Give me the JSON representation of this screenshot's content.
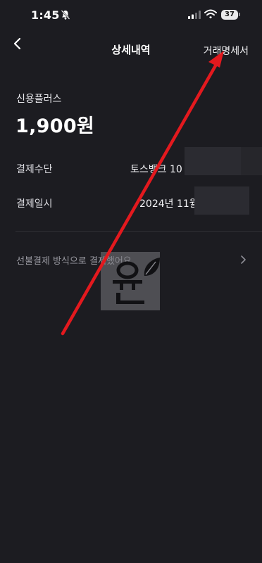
{
  "status_bar": {
    "time": "1:45",
    "battery_level": "37"
  },
  "nav": {
    "title": "상세내역",
    "action_label": "거래명세서"
  },
  "transaction": {
    "merchant": "신용플러스",
    "amount": "1,900원"
  },
  "details": [
    {
      "label": "결제수단",
      "value": "토스뱅크 10"
    },
    {
      "label": "결제일시",
      "value": "2024년 11월"
    }
  ],
  "payment_link": {
    "text": "선불결제 방식으로 결제했어요"
  },
  "watermark": {
    "text": "윤"
  },
  "colors": {
    "background": "#1c1c21",
    "annotation_arrow": "#e3191e"
  }
}
